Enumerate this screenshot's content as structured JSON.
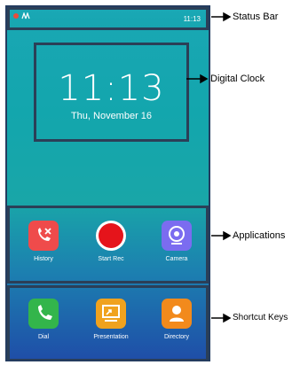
{
  "status_bar": {
    "time": "11:13"
  },
  "clock": {
    "time": "11:13",
    "date": "Thu, November 16"
  },
  "applications": [
    {
      "label": "History",
      "icon": "history-icon",
      "color": "#ef4b4b"
    },
    {
      "label": "Start Rec",
      "icon": "record-icon",
      "color": "#ffffff"
    },
    {
      "label": "Camera",
      "icon": "camera-icon",
      "color": "#7b6cf0"
    }
  ],
  "shortcut_keys": [
    {
      "label": "Dial",
      "icon": "phone-icon",
      "color": "#33b54b"
    },
    {
      "label": "Presentation",
      "icon": "presentation-icon",
      "color": "#f0a21e"
    },
    {
      "label": "Directory",
      "icon": "contact-icon",
      "color": "#f28a1c"
    }
  ],
  "callouts": {
    "status_bar": "Status Bar",
    "digital_clock": "Digital Clock",
    "applications": "Applications",
    "shortcut_keys": "Shortcut Keys"
  }
}
